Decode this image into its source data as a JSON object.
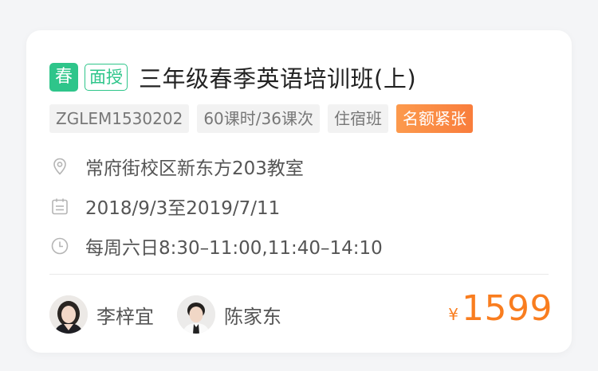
{
  "course": {
    "season_badge": "春",
    "mode_badge": "面授",
    "title": "三年级春季英语培训班(上)"
  },
  "tags": [
    {
      "label": "ZGLEM1530202",
      "style": "normal"
    },
    {
      "label": "60课时/36课次",
      "style": "normal"
    },
    {
      "label": "住宿班",
      "style": "normal"
    },
    {
      "label": "名额紧张",
      "style": "hot"
    }
  ],
  "info": {
    "location": {
      "icon": "location-pin-icon",
      "text": "常府街校区新东方203教室"
    },
    "dates": {
      "icon": "calendar-icon",
      "text": "2018/9/3至2019/7/11"
    },
    "schedule": {
      "icon": "clock-icon",
      "text": "每周六日8:30–11:00,11:40–14:10"
    }
  },
  "teachers": [
    {
      "name": "李梓宜",
      "avatar": "female-teacher-avatar"
    },
    {
      "name": "陈家东",
      "avatar": "male-teacher-avatar"
    }
  ],
  "price": {
    "currency": "¥",
    "value": "1599"
  },
  "colors": {
    "accent_green": "#2ec58a",
    "hot_orange": "#f97d3c",
    "price_orange": "#f97d1f"
  }
}
